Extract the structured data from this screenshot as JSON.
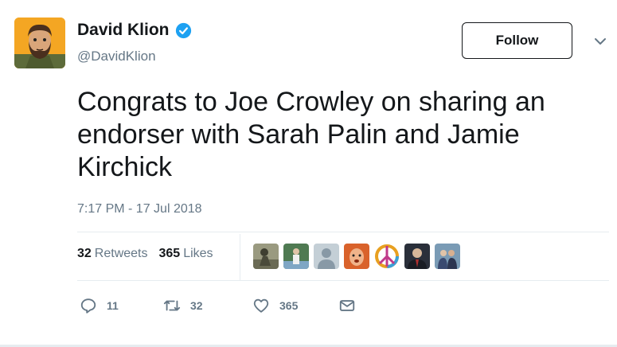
{
  "author": {
    "name": "David Klion",
    "handle": "@DavidKlion",
    "verified": true,
    "avatar_icon": "bearded-man-cartoon-avatar"
  },
  "follow_label": "Follow",
  "tweet": {
    "text": "Congrats to Joe Crowley on sharing an endorser with Sarah Palin and Jamie Kirchick",
    "timestamp": "7:17 PM - 17 Jul 2018"
  },
  "stats": {
    "retweets_count": "32",
    "retweets_label": "Retweets",
    "likes_count": "365",
    "likes_label": "Likes"
  },
  "liked_by": [
    {
      "icon": "statue-photo-avatar",
      "color": "#8a8a70"
    },
    {
      "icon": "person-outdoor-avatar",
      "color": "#5b7d9c"
    },
    {
      "icon": "default-egg-avatar",
      "color": "#c4cfd6"
    },
    {
      "icon": "cartoon-face-avatar",
      "color": "#d9622b"
    },
    {
      "icon": "peace-sign-avatar",
      "color": "#ffffff"
    },
    {
      "icon": "man-in-suit-avatar",
      "color": "#2a2f3a"
    },
    {
      "icon": "two-people-avatar",
      "color": "#7a9bb5"
    }
  ],
  "actions": {
    "replies": "11",
    "retweets": "32",
    "likes": "365"
  },
  "colors": {
    "verified_blue": "#1da1f2",
    "text_primary": "#14171a",
    "text_secondary": "#657786",
    "divider": "#e6ecf0"
  }
}
